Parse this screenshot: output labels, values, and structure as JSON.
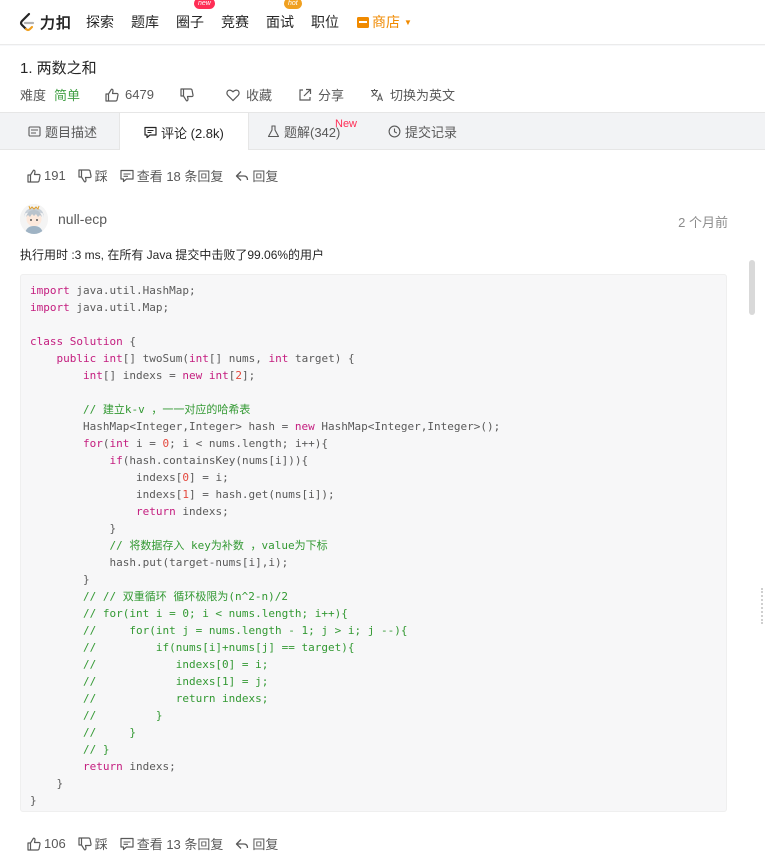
{
  "nav": {
    "logo_text": "力扣",
    "items": [
      {
        "label": "探索"
      },
      {
        "label": "题库"
      },
      {
        "label": "圈子",
        "badge": "new"
      },
      {
        "label": "竞赛"
      },
      {
        "label": "面试",
        "badge": "hot"
      },
      {
        "label": "职位"
      }
    ],
    "shop_label": "商店",
    "accent": "#f08a00"
  },
  "problem": {
    "title": "1. 两数之和",
    "difficulty_label": "难度",
    "difficulty": "简单",
    "likes": "6479",
    "favorite_label": "收藏",
    "share_label": "分享",
    "switch_lang_label": "切换为英文"
  },
  "tabs": {
    "description": "题目描述",
    "comments": "评论 (2.8k)",
    "solutions": "题解(342)",
    "solutions_new": "New",
    "submissions": "提交记录"
  },
  "prev_comment": {
    "likes": "191",
    "dislike_label": "踩",
    "view_replies": "查看 18 条回复",
    "reply_label": "回复"
  },
  "comment": {
    "author": "null-ecp",
    "time": "2 个月前",
    "summary": "执行用时 :3 ms, 在所有 Java 提交中击败了99.06%的用户",
    "likes": "106",
    "dislike_label": "踩",
    "view_replies": "查看 13 条回复",
    "reply_label": "回复"
  }
}
